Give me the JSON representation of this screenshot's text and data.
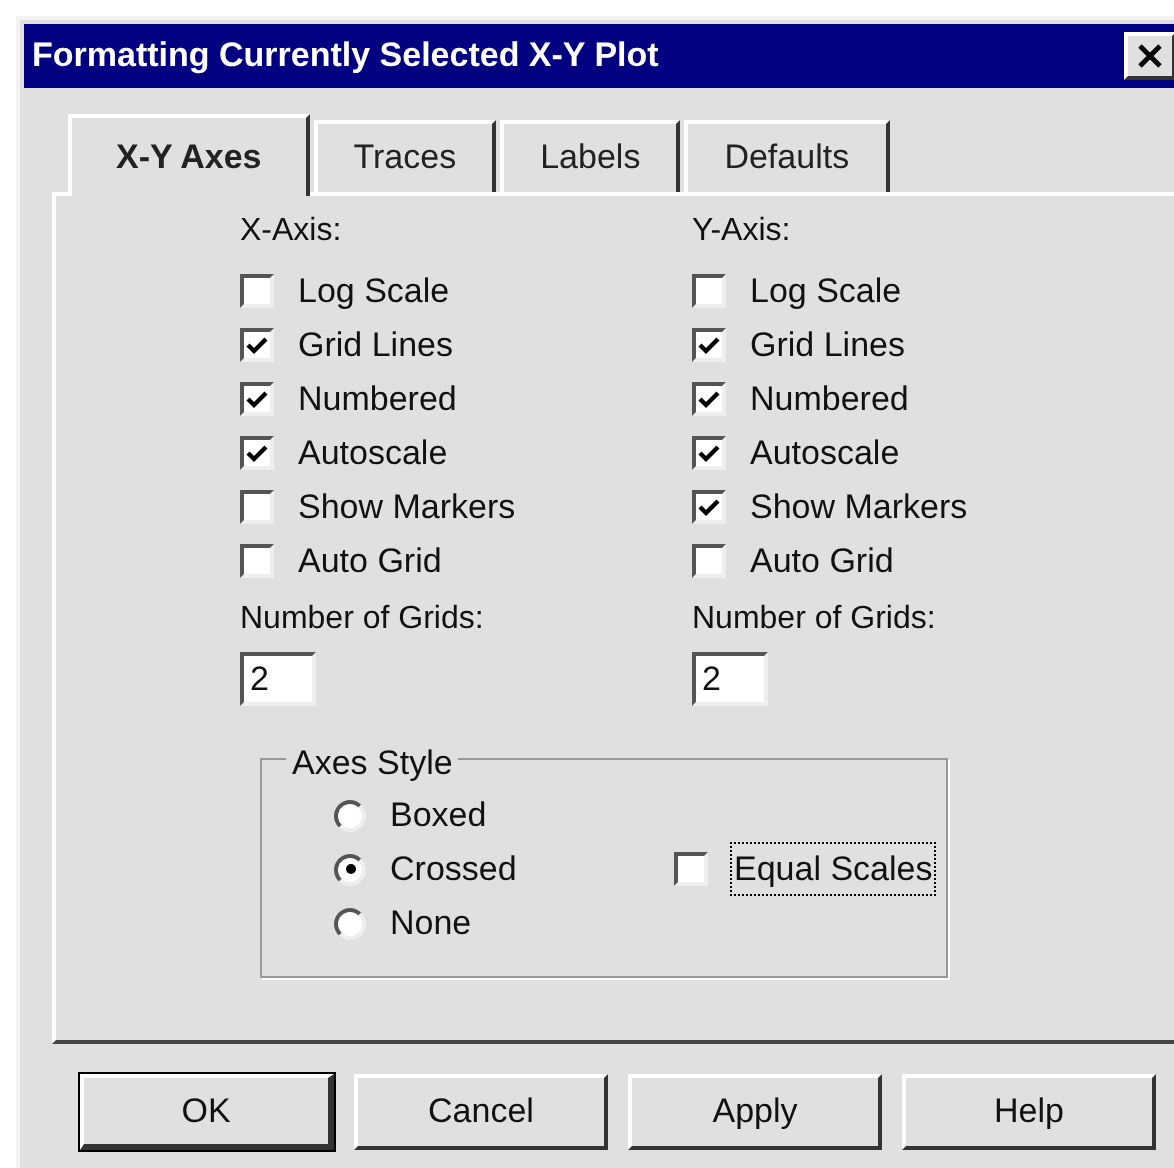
{
  "window": {
    "title": "Formatting Currently Selected X-Y Plot"
  },
  "tabs": [
    {
      "label": "X-Y Axes",
      "selected": true
    },
    {
      "label": "Traces",
      "selected": false
    },
    {
      "label": "Labels",
      "selected": false
    },
    {
      "label": "Defaults",
      "selected": false
    }
  ],
  "axes": [
    {
      "heading": "X-Axis:",
      "options": [
        {
          "label": "Log Scale",
          "checked": false
        },
        {
          "label": "Grid Lines",
          "checked": true
        },
        {
          "label": "Numbered",
          "checked": true
        },
        {
          "label": "Autoscale",
          "checked": true
        },
        {
          "label": "Show Markers",
          "checked": false
        },
        {
          "label": "Auto Grid",
          "checked": false
        }
      ],
      "grids_label": "Number of Grids:",
      "grids_value": "2"
    },
    {
      "heading": "Y-Axis:",
      "options": [
        {
          "label": "Log Scale",
          "checked": false
        },
        {
          "label": "Grid Lines",
          "checked": true
        },
        {
          "label": "Numbered",
          "checked": true
        },
        {
          "label": "Autoscale",
          "checked": true
        },
        {
          "label": "Show Markers",
          "checked": true
        },
        {
          "label": "Auto Grid",
          "checked": false
        }
      ],
      "grids_label": "Number of Grids:",
      "grids_value": "2"
    }
  ],
  "axes_style": {
    "title": "Axes Style",
    "options": [
      {
        "label": "Boxed",
        "selected": false
      },
      {
        "label": "Crossed",
        "selected": true
      },
      {
        "label": "None",
        "selected": false
      }
    ],
    "equal_scales": {
      "label": "Equal Scales",
      "checked": false,
      "focused": true
    }
  },
  "buttons": [
    {
      "label": "OK",
      "default": true
    },
    {
      "label": "Cancel",
      "default": false
    },
    {
      "label": "Apply",
      "default": false
    },
    {
      "label": "Help",
      "default": false
    }
  ]
}
